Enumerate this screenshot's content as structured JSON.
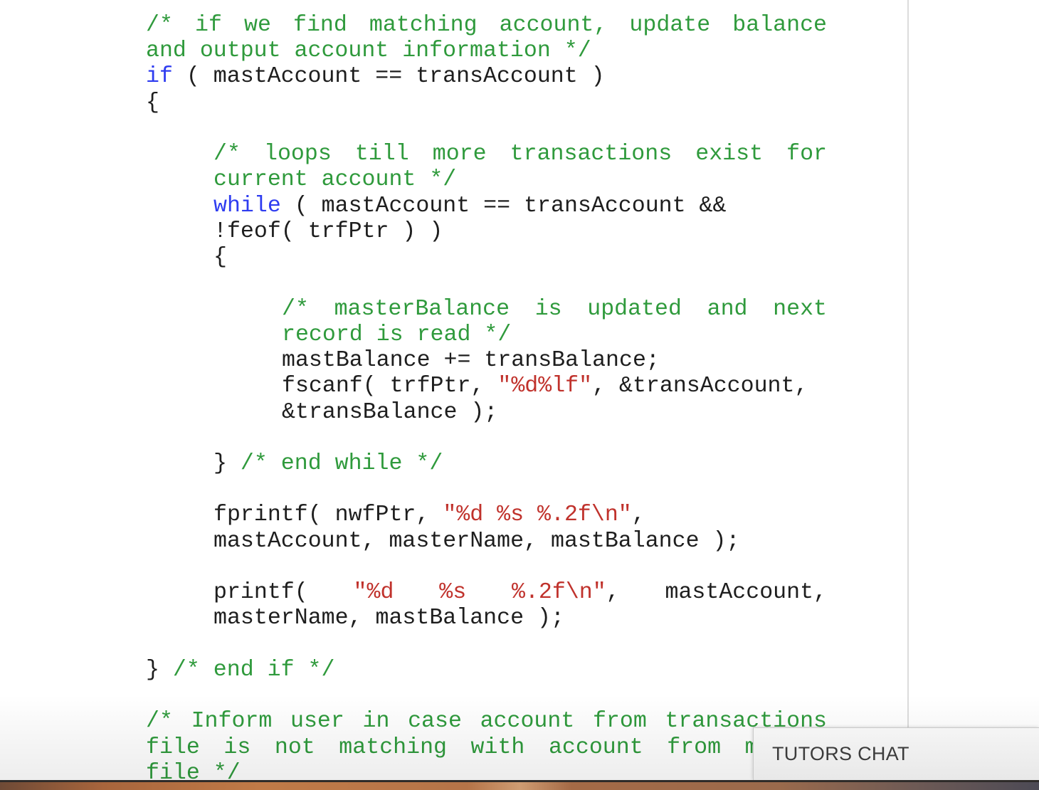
{
  "colors": {
    "comment": "#2f9a3c",
    "keyword": "#2e3cf0",
    "string": "#c0322c",
    "text": "#1e1e1e"
  },
  "code": {
    "lines": [
      [
        "/* if we find matching account, update balance"
      ],
      [
        "and output account information */"
      ],
      [
        "if",
        " ( mastAccount == transAccount )"
      ],
      [
        "{"
      ],
      [],
      [
        "/* loops till more transactions exist for"
      ],
      [
        "current account */"
      ],
      [
        "while",
        " ( mastAccount == transAccount &&"
      ],
      [
        "!feof( trfPtr ) )"
      ],
      [
        "{"
      ],
      [],
      [
        "/* masterBalance is updated and next"
      ],
      [
        "record is read */"
      ],
      [
        "mastBalance += transBalance;"
      ],
      [
        "fscanf( trfPtr, ",
        "\"%d%lf\"",
        ", &transAccount,"
      ],
      [
        "&transBalance );"
      ],
      [],
      [
        "} ",
        "/* end while */"
      ],
      [],
      [
        "fprintf( nwfPtr, ",
        "\"%d %s %.2f\\n\"",
        ","
      ],
      [
        "mastAccount, masterName, mastBalance );"
      ],
      [],
      [
        "printf( ",
        "\"%d %s %.2f\\n\"",
        ", mastAccount,"
      ],
      [
        "masterName, mastBalance );"
      ],
      [],
      [
        "} ",
        "/* end if */"
      ],
      [],
      [
        "/* Inform user in case account from transactions"
      ],
      [
        "file is not matching with account from m"
      ],
      [
        "file */"
      ]
    ]
  },
  "chat_widget": {
    "label": "TUTORS CHAT"
  }
}
